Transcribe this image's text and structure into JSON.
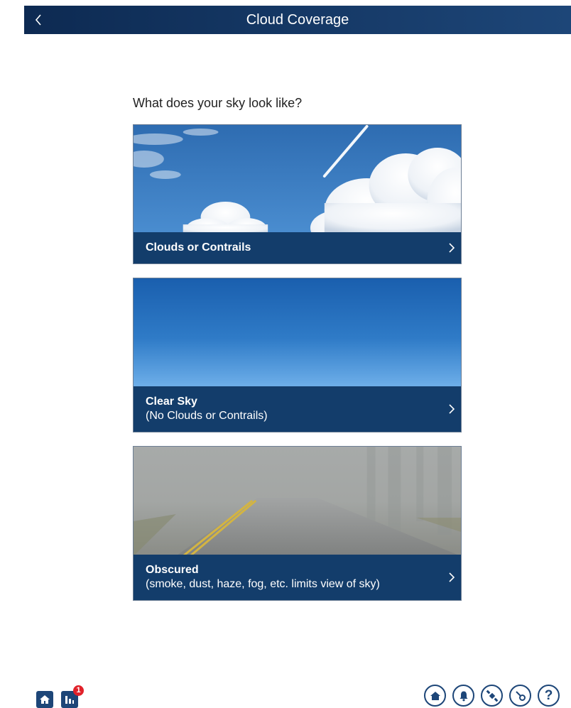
{
  "header": {
    "title": "Cloud Coverage",
    "back_icon": "chevron-left-icon"
  },
  "prompt": "What does your sky look like?",
  "options": [
    {
      "title": "Clouds or Contrails",
      "subtitle": "",
      "photo": "blue sky with cumulus clouds and a contrail"
    },
    {
      "title": "Clear Sky",
      "subtitle": "(No Clouds or Contrails)",
      "photo": "clear blue sky gradient"
    },
    {
      "title": "Obscured",
      "subtitle": "(smoke, dust, haze, fog, etc. limits view of sky)",
      "photo": "foggy road"
    }
  ],
  "bottom_nav": {
    "left": [
      {
        "icon": "home-icon"
      },
      {
        "icon": "chart-icon",
        "badge": "1"
      }
    ],
    "right": [
      {
        "icon": "home-icon"
      },
      {
        "icon": "bell-icon"
      },
      {
        "icon": "satellite-icon"
      },
      {
        "icon": "link-icon"
      },
      {
        "icon": "help-icon",
        "glyph": "?"
      }
    ]
  },
  "colors": {
    "header_gradient_start": "#0d2a52",
    "header_gradient_end": "#1d4678",
    "caption_bg": "#133d6b",
    "badge": "#e1222a",
    "icon": "#1d4678"
  }
}
